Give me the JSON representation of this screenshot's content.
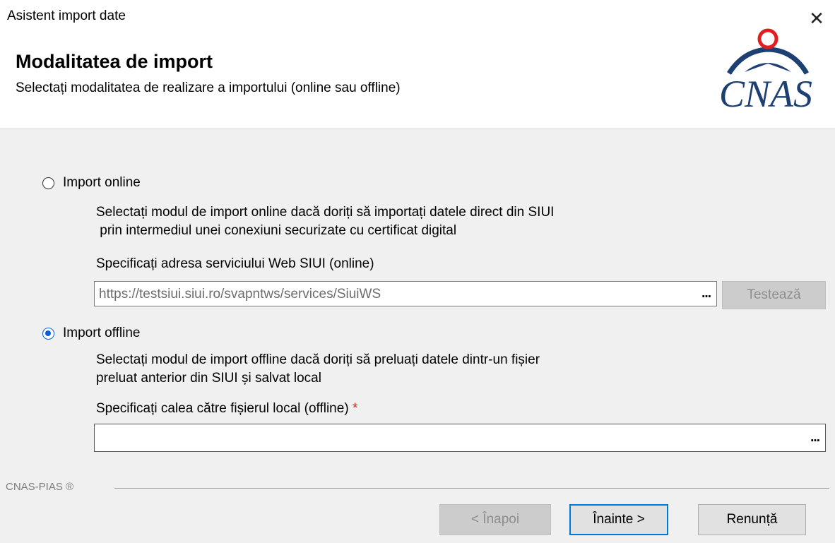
{
  "window": {
    "title": "Asistent import date",
    "close_icon": "close-icon"
  },
  "header": {
    "title": "Modalitatea de import",
    "subtitle": "Selectați modalitatea de realizare a importului (online sau offline)",
    "logo_text": "CNAS"
  },
  "online": {
    "label": "Import online",
    "checked": false,
    "description": "Selectați modul de import online dacă doriți să importați datele direct din SIUI\n prin intermediul unei conexiuni securizate cu certificat digital",
    "field_label": "Specificați adresa serviciului Web SIUI (online)",
    "url_value": "https://testsiui.siui.ro/svapntws/services/SiuiWS",
    "browse_label": "...",
    "test_label": "Testează"
  },
  "offline": {
    "label": "Import offline",
    "checked": true,
    "description": "Selectați modul de import offline dacă doriți să preluați datele dintr-un fișier\npreluat anterior din SIUI și salvat local",
    "field_label": "Specificați calea către fișierul local (offline)",
    "required_mark": "*",
    "path_value": "",
    "browse_label": "..."
  },
  "footer": {
    "brand": "CNAS-PIAS ®",
    "back_label": "< Înapoi",
    "next_label": "Înainte >",
    "cancel_label": "Renunță"
  },
  "colors": {
    "accent": "#0078d7",
    "logo": "#1e3f72",
    "required": "#e02020"
  }
}
